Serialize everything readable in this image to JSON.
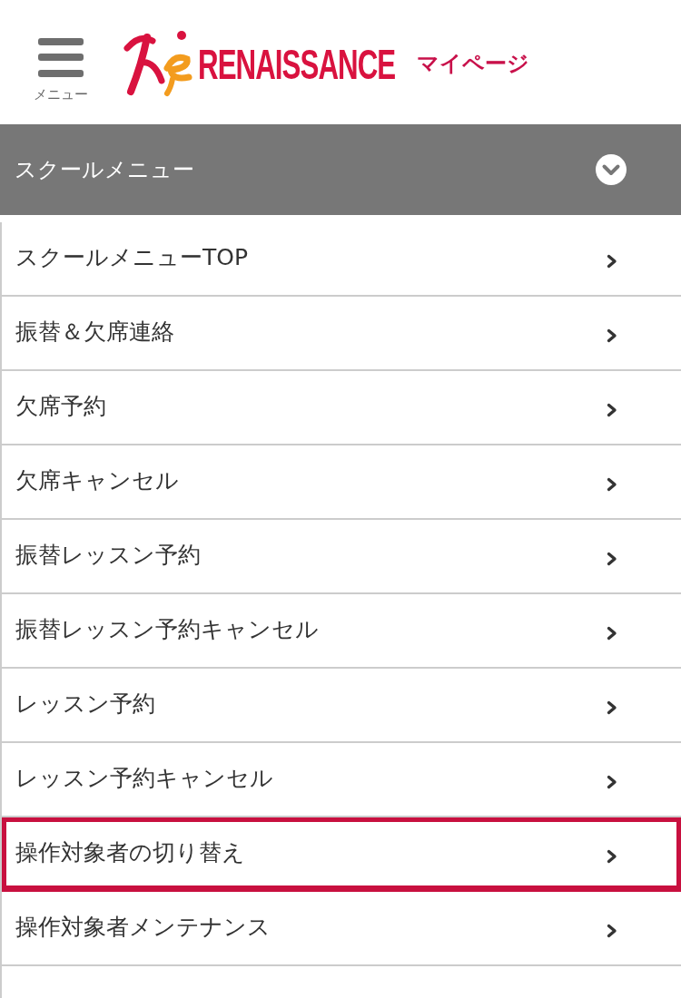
{
  "header": {
    "menu_button": {
      "label": "メニュー"
    },
    "logo": {
      "text": "RENAISSANCE"
    },
    "page_title": "マイページ"
  },
  "section": {
    "title": "スクールメニュー"
  },
  "items": [
    {
      "label": "スクールメニューTOP",
      "highlighted": false
    },
    {
      "label": "振替＆欠席連絡",
      "highlighted": false
    },
    {
      "label": "欠席予約",
      "highlighted": false
    },
    {
      "label": "欠席キャンセル",
      "highlighted": false
    },
    {
      "label": "振替レッスン予約",
      "highlighted": false
    },
    {
      "label": "振替レッスン予約キャンセル",
      "highlighted": false
    },
    {
      "label": "レッスン予約",
      "highlighted": false
    },
    {
      "label": "レッスン予約キャンセル",
      "highlighted": false
    },
    {
      "label": "操作対象者の切り替え",
      "highlighted": true
    },
    {
      "label": "操作対象者メンテナンス",
      "highlighted": false
    }
  ]
}
